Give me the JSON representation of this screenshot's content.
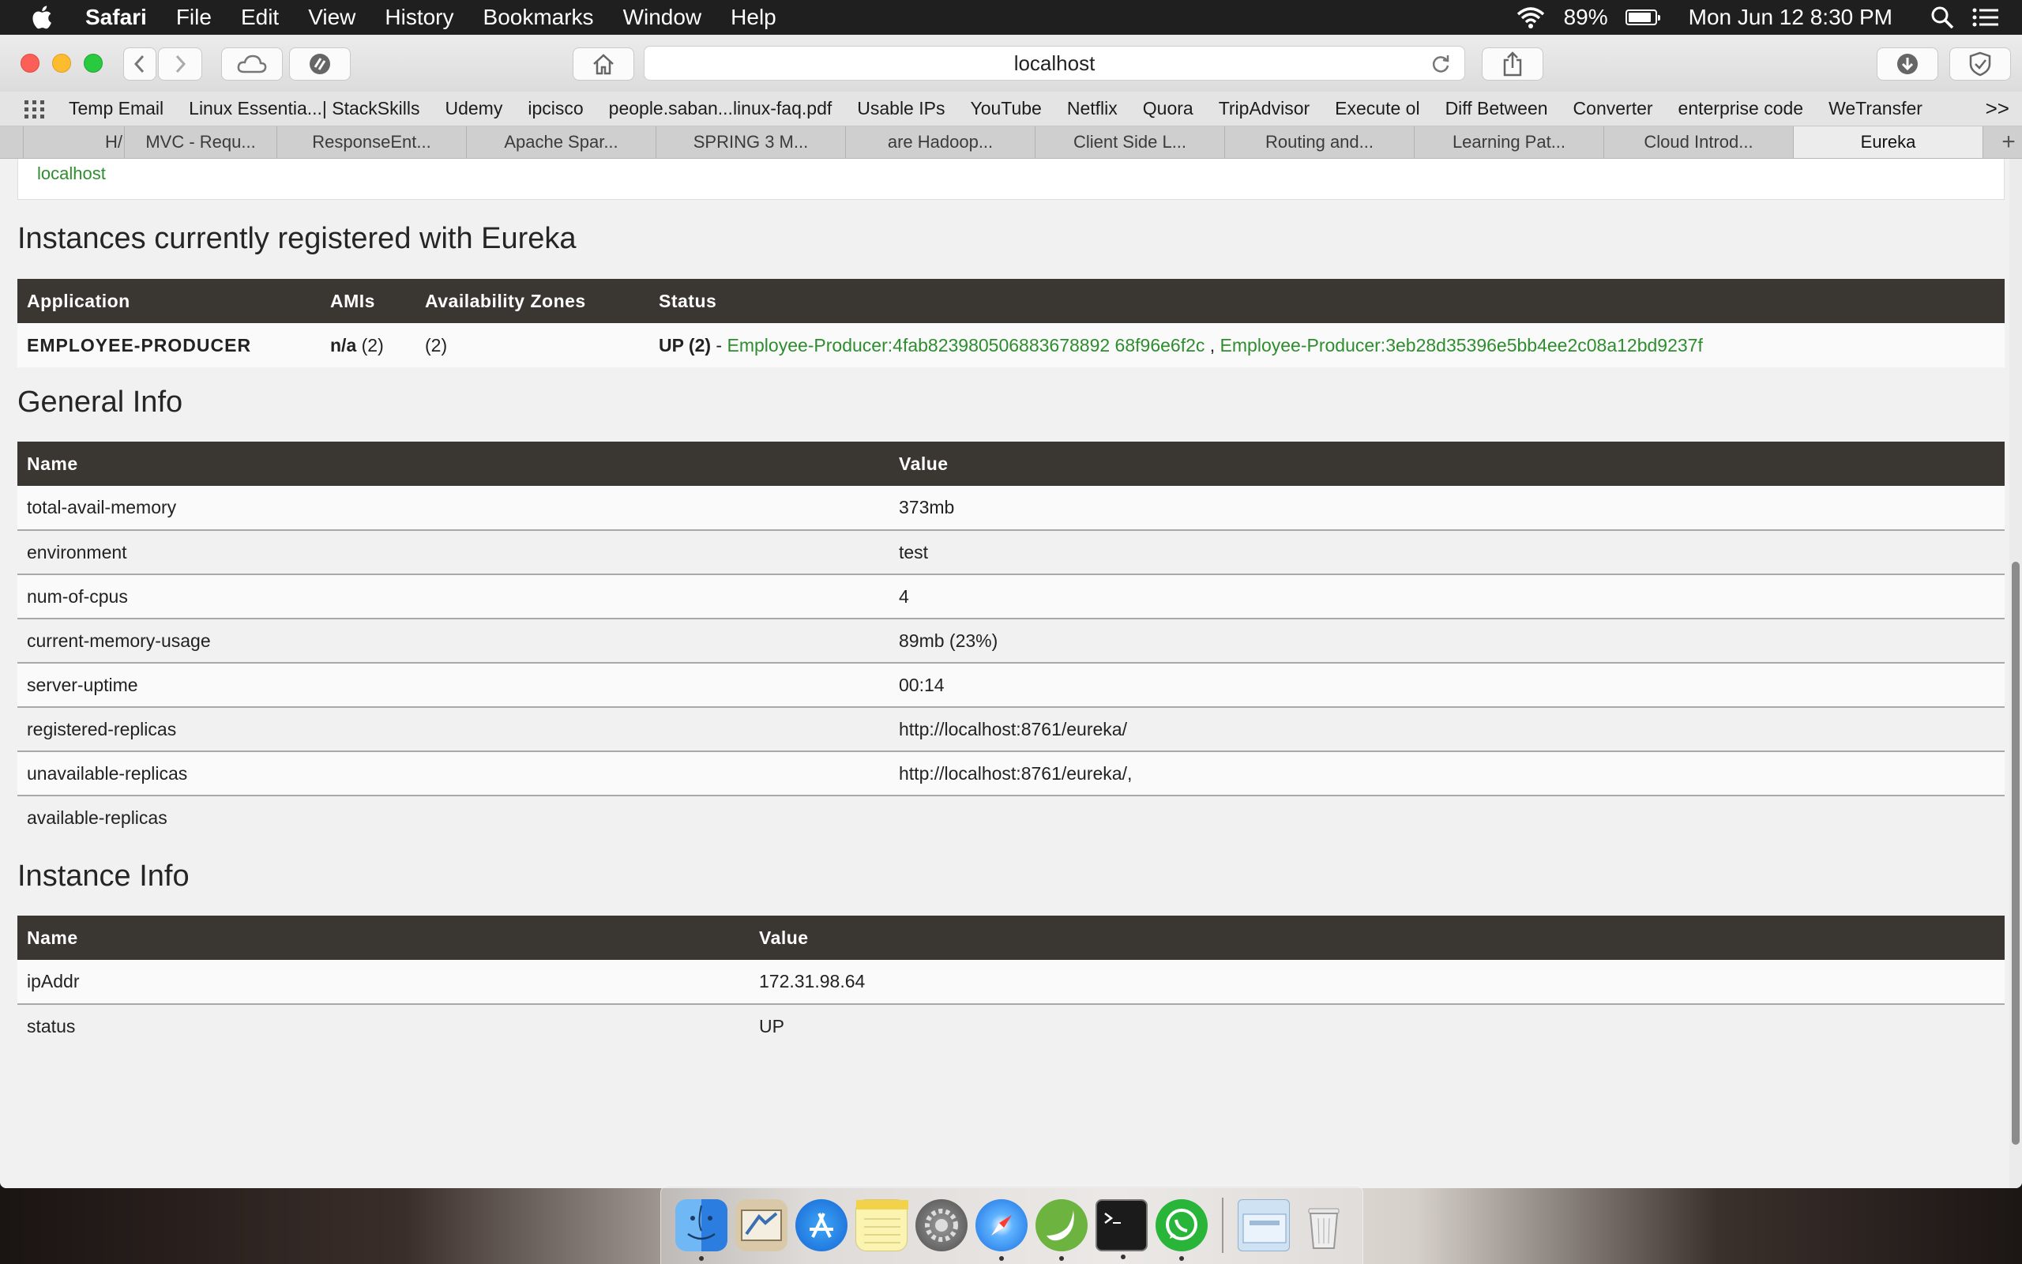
{
  "menubar": {
    "app_name": "Safari",
    "items": [
      "File",
      "Edit",
      "View",
      "History",
      "Bookmarks",
      "Window",
      "Help"
    ],
    "battery_percent": "89%",
    "battery_level": 0.89,
    "clock": "Mon Jun 12  8:30 PM"
  },
  "browser": {
    "address": "localhost",
    "bookmarks": [
      "Temp Email",
      "Linux Essentia...| StackSkills",
      "Udemy",
      "ipcisco",
      "people.saban...linux-faq.pdf",
      "Usable IPs",
      "YouTube",
      "Netflix",
      "Quora",
      "TripAdvisor",
      "Execute ol",
      "Diff Between",
      "Converter",
      "enterprise code",
      "WeTransfer"
    ],
    "bookmarks_overflow": ">>",
    "tabs": [
      "H/",
      "MVC - Requ...",
      "ResponseEnt...",
      "Apache Spar...",
      "SPRING 3 M...",
      "are Hadoop...",
      "Client Side L...",
      "Routing and...",
      "Learning Pat...",
      "Cloud Introd...",
      "Eureka"
    ],
    "active_tab": "Eureka",
    "new_tab_symbol": "+"
  },
  "page": {
    "top_link": "localhost",
    "instances": {
      "heading": "Instances currently registered with Eureka",
      "columns": [
        "Application",
        "AMIs",
        "Availability Zones",
        "Status"
      ],
      "row": {
        "application": "EMPLOYEE-PRODUCER",
        "amis_bold": "n/a",
        "amis_count": " (2)",
        "zones": "(2)",
        "status_prefix": "UP (2)",
        "status_sep": " - ",
        "instance_1": "Employee-Producer:4fab823980506883678892 68f96e6f2c",
        "comma": " , ",
        "instance_2": "Employee-Producer:3eb28d35396e5bb4ee2c08a12bd9237f"
      }
    },
    "general": {
      "heading": "General Info",
      "columns": [
        "Name",
        "Value"
      ],
      "rows": [
        [
          "total-avail-memory",
          "373mb"
        ],
        [
          "environment",
          "test"
        ],
        [
          "num-of-cpus",
          "4"
        ],
        [
          "current-memory-usage",
          "89mb (23%)"
        ],
        [
          "server-uptime",
          "00:14"
        ],
        [
          "registered-replicas",
          "http://localhost:8761/eureka/"
        ],
        [
          "unavailable-replicas",
          "http://localhost:8761/eureka/,"
        ],
        [
          "available-replicas",
          ""
        ]
      ]
    },
    "instance_info": {
      "heading": "Instance Info",
      "columns": [
        "Name",
        "Value"
      ],
      "rows": [
        [
          "ipAddr",
          "172.31.98.64"
        ],
        [
          "status",
          "UP"
        ]
      ]
    }
  },
  "dock": {
    "apps": [
      "finder-icon",
      "mail-icon",
      "app-store-icon",
      "notes-icon",
      "system-preferences-icon",
      "safari-icon",
      "spring-icon",
      "terminal-icon",
      "whatsapp-icon"
    ],
    "extras": [
      "downloads-folder-icon",
      "trash-icon"
    ]
  },
  "colors": {
    "table_header": "#3a3631",
    "link_green": "#2e8d2e",
    "menubar": "#1f1f1f"
  }
}
